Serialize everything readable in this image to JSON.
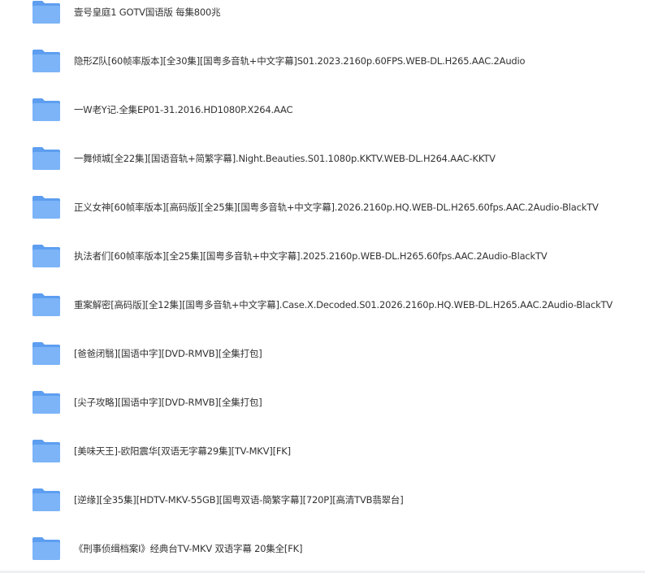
{
  "colors": {
    "folder_back": "#5d9ef0",
    "folder_front": "#7cb4f7",
    "text": "#333333"
  },
  "file_list": {
    "icon": "folder-icon",
    "items": [
      {
        "name": "壹号皇庭1 GOTV国语版 每集800兆"
      },
      {
        "name": "隐形Z队[60帧率版本][全30集][国粤多音轨+中文字幕]S01.2023.2160p.60FPS.WEB-DL.H265.AAC.2Audio"
      },
      {
        "name": "一W老Y记.全集EP01-31.2016.HD1080P.X264.AAC"
      },
      {
        "name": "一舞倾城[全22集][国语音轨+简繁字幕].Night.Beauties.S01.1080p.KKTV.WEB-DL.H264.AAC-KKTV"
      },
      {
        "name": "正义女神[60帧率版本][高码版][全25集][国粤多音轨+中文字幕].2026.2160p.HQ.WEB-DL.H265.60fps.AAC.2Audio-BlackTV"
      },
      {
        "name": "执法者们[60帧率版本][全25集][国粤多音轨+中文字幕].2025.2160p.WEB-DL.H265.60fps.AAC.2Audio-BlackTV"
      },
      {
        "name": "重案解密[高码版][全12集][国粤多音轨+中文字幕].Case.X.Decoded.S01.2026.2160p.HQ.WEB-DL.H265.AAC.2Audio-BlackTV"
      },
      {
        "name": "[爸爸闭翳][国语中字][DVD-RMVB][全集打包]"
      },
      {
        "name": "[尖子攻略][国语中字][DVD-RMVB][全集打包]"
      },
      {
        "name": "[美味天王]-欧阳震华[双语无字幕29集][TV-MKV][FK]"
      },
      {
        "name": "[逆缘][全35集][HDTV-MKV-55GB][国粤双语-簡繁字幕][720P][高清TVB翡翠台]"
      },
      {
        "name": "《刑事侦缉档案I》经典台TV-MKV 双语字幕 20集全[FK]"
      }
    ]
  }
}
